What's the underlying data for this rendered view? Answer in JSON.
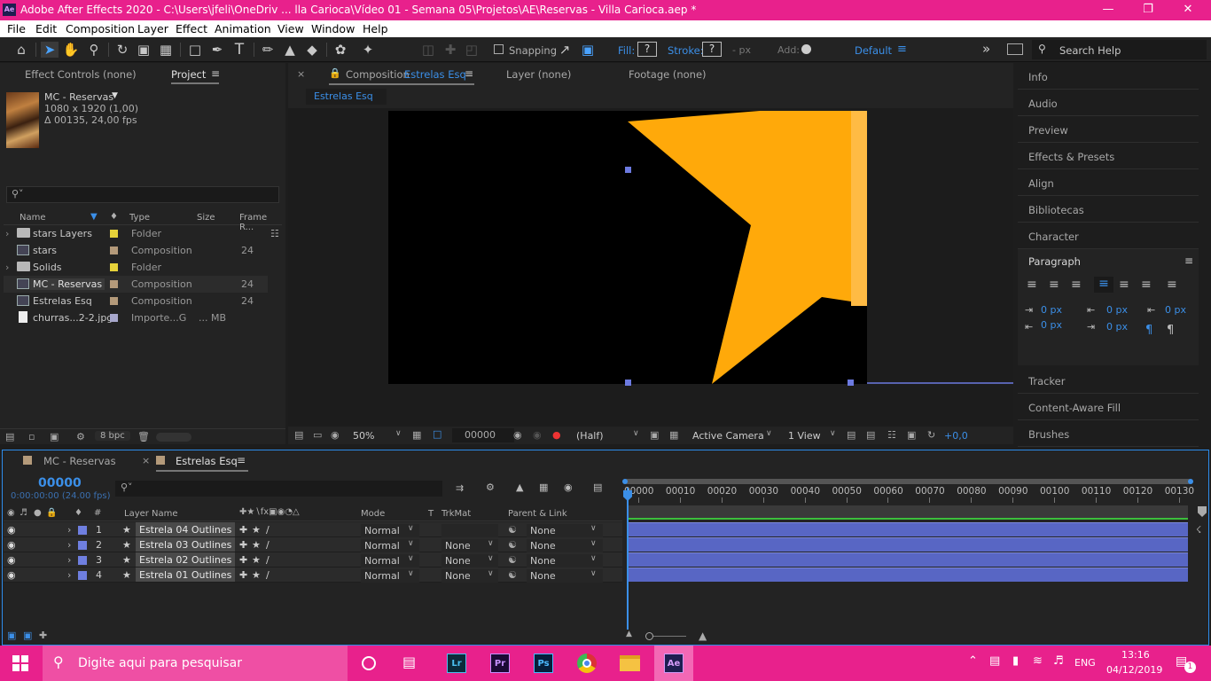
{
  "titlebar": {
    "icon": "Ae",
    "title": "Adobe After Effects 2020 - C:\\Users\\jfeli\\OneDriv ... lla Carioca\\Vídeo 01 - Semana 05\\Projetos\\AE\\Reservas - Villa Carioca.aep *"
  },
  "menu": [
    "File",
    "Edit",
    "Composition",
    "Layer",
    "Effect",
    "Animation",
    "View",
    "Window",
    "Help"
  ],
  "toolbar": {
    "snapping": "Snapping",
    "fill": "Fill:",
    "fill_value": "?",
    "stroke": "Stroke:",
    "stroke_value": "?",
    "stroke_unit": "-  px",
    "add": "Add:",
    "workspace": "Default",
    "search_placeholder": "Search Help"
  },
  "project_panel": {
    "tab_effect_controls": "Effect Controls (none)",
    "tab_project": "Project",
    "item_name": "MC - Reservas",
    "item_dims": "1080 x 1920 (1,00)",
    "item_duration": "Δ 00135, 24,00 fps",
    "columns": {
      "name": "Name",
      "type": "Type",
      "size": "Size",
      "frame_rate": "Frame R..."
    },
    "items": [
      {
        "name": "stars Layers",
        "type": "Folder",
        "size": "",
        "fr": "",
        "color": "#e6d23a",
        "kind": "folder"
      },
      {
        "name": "stars",
        "type": "Composition",
        "size": "",
        "fr": "24",
        "color": "#b49a7a",
        "kind": "comp"
      },
      {
        "name": "Solids",
        "type": "Folder",
        "size": "",
        "fr": "",
        "color": "#e6d23a",
        "kind": "folder"
      },
      {
        "name": "MC - Reservas",
        "type": "Composition",
        "size": "",
        "fr": "24",
        "color": "#b49a7a",
        "kind": "comp"
      },
      {
        "name": "Estrelas Esq",
        "type": "Composition",
        "size": "",
        "fr": "24",
        "color": "#b49a7a",
        "kind": "comp"
      },
      {
        "name": "churras...2-2.jpg",
        "type": "Importe...G",
        "size": "... MB",
        "fr": "",
        "color": "#a7a7cc",
        "kind": "file"
      }
    ],
    "bpc": "8 bpc"
  },
  "composition_panel": {
    "tab_comp_prefix": "Composition",
    "tab_comp_name": "Estrelas Esq",
    "tab_layer": "Layer  (none)",
    "tab_footage": "Footage  (none)",
    "subtab": "Estrelas Esq",
    "zoom": "50%",
    "timecode": "00000",
    "resolution": "(Half)",
    "camera": "Active Camera",
    "views": "1 View",
    "exposure": "+0,0"
  },
  "right_panels": [
    "Info",
    "Audio",
    "Preview",
    "Effects & Presets",
    "Align",
    "Bibliotecas",
    "Character"
  ],
  "paragraph": {
    "title": "Paragraph",
    "values": [
      "0 px",
      "0 px",
      "0 px",
      "0 px",
      "0 px"
    ]
  },
  "right_panels_bottom": [
    "Tracker",
    "Content-Aware Fill",
    "Brushes"
  ],
  "timeline": {
    "tab1": "MC - Reservas",
    "tab2": "Estrelas Esq",
    "timecode": "00000",
    "timecode_sub": "0:00:00:00 (24.00 fps)",
    "columns": {
      "layer_name": "Layer Name",
      "mode": "Mode",
      "t": "T",
      "trkmat": "TrkMat",
      "parent": "Parent & Link"
    },
    "ruler": [
      "00000",
      "00010",
      "00020",
      "00030",
      "00040",
      "00050",
      "00060",
      "00070",
      "00080",
      "00090",
      "00100",
      "00110",
      "00120",
      "00130"
    ],
    "layers": [
      {
        "num": "1",
        "name": "Estrela 04 Outlines",
        "mode": "Normal",
        "trkmat": "",
        "parent": "None"
      },
      {
        "num": "2",
        "name": "Estrela 03 Outlines",
        "mode": "Normal",
        "trkmat": "None",
        "parent": "None"
      },
      {
        "num": "3",
        "name": "Estrela 02 Outlines",
        "mode": "Normal",
        "trkmat": "None",
        "parent": "None"
      },
      {
        "num": "4",
        "name": "Estrela 01 Outlines",
        "mode": "Normal",
        "trkmat": "None",
        "parent": "None"
      }
    ]
  },
  "taskbar": {
    "search": "Digite aqui para pesquisar",
    "apps": [
      "Lr",
      "Pr",
      "Ps",
      "Ae"
    ],
    "lang": "ENG",
    "time": "13:16",
    "date": "04/12/2019",
    "notifications": "1"
  },
  "colors": {
    "accent": "#e8218c",
    "star": "#ffa90a",
    "layer_bar": "#5866c4",
    "highlight": "#2d8ceb"
  }
}
